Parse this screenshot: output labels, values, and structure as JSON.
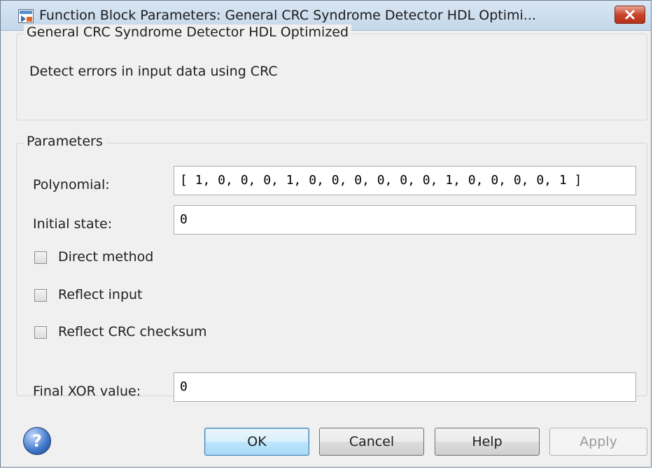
{
  "window": {
    "title": "Function Block Parameters: General CRC Syndrome Detector HDL Optimi..."
  },
  "description": {
    "legend": "General CRC Syndrome Detector HDL Optimized",
    "text": "Detect errors in input data using CRC"
  },
  "parameters": {
    "legend": "Parameters",
    "polynomial_label": "Polynomial:",
    "polynomial_value": "[ 1, 0, 0, 0, 1, 0, 0, 0, 0, 0, 0, 1, 0, 0, 0, 0, 1 ]",
    "initial_state_label": "Initial state:",
    "initial_state_value": "0",
    "direct_method_label": "Direct method",
    "direct_method_checked": false,
    "reflect_input_label": "Reflect input",
    "reflect_input_checked": false,
    "reflect_crc_label": "Reflect CRC checksum",
    "reflect_crc_checked": false,
    "final_xor_label": "Final XOR value:",
    "final_xor_value": "0"
  },
  "buttons": {
    "ok": "OK",
    "cancel": "Cancel",
    "help": "Help",
    "apply": "Apply"
  },
  "icons": {
    "app": "simulink-block-icon",
    "close": "close-icon",
    "help": "help-icon"
  },
  "colors": {
    "close_button": "#c8452b",
    "ok_button_border": "#3c7fb1",
    "help_icon": "#3d74c7"
  }
}
